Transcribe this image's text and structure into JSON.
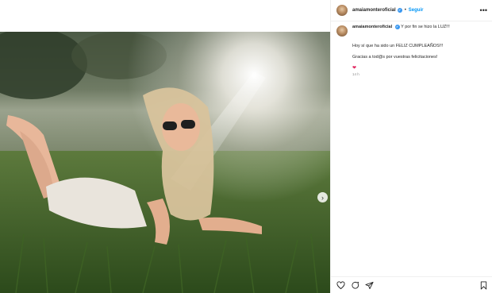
{
  "post": {
    "username": "amaiamonteroficial",
    "verified_glyph": "✔",
    "separator": "•",
    "follow_label": "Seguir",
    "more_glyph": "•••",
    "caption_title": "Y por fin se hizo la LUZ!!!",
    "caption_line1": "Hoy sí que ha sido un FELIZ CUMPLEAÑOS!!!",
    "caption_line2": "Gracias a tod@s por vuestras felicitaciones!",
    "emoji": "❤",
    "timestamp": "14 h"
  },
  "media": {
    "next_glyph": "›"
  },
  "icons": {
    "like": "heart-icon",
    "comment": "comment-icon",
    "share": "share-icon",
    "save": "bookmark-icon"
  },
  "colors": {
    "follow": "#0095f6",
    "verified": "#3897f0",
    "heart": "#e0245e",
    "muted": "#8e8e8e"
  }
}
